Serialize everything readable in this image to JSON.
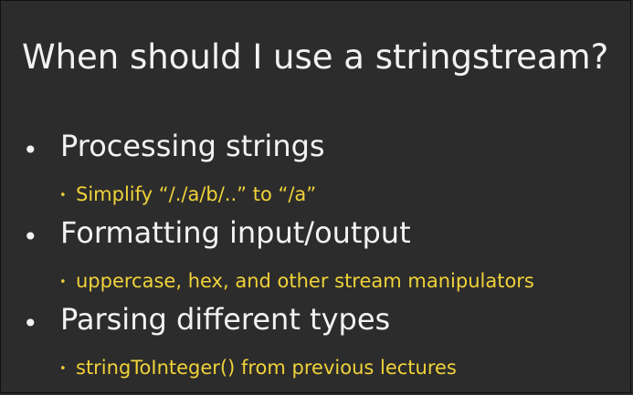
{
  "slide": {
    "title": "When should I use a stringstream?",
    "bullets": [
      {
        "text": "Processing strings",
        "sub": "Simplify “/./a/b/..” to “/a”"
      },
      {
        "text": "Formatting input/output",
        "sub": "uppercase, hex, and other stream manipulators"
      },
      {
        "text": "Parsing different types",
        "sub": "stringToInteger() from previous lectures"
      }
    ]
  },
  "colors": {
    "background": "#2c2c2c",
    "title_text": "#f2f2f2",
    "sub_text": "#f0d23a"
  }
}
